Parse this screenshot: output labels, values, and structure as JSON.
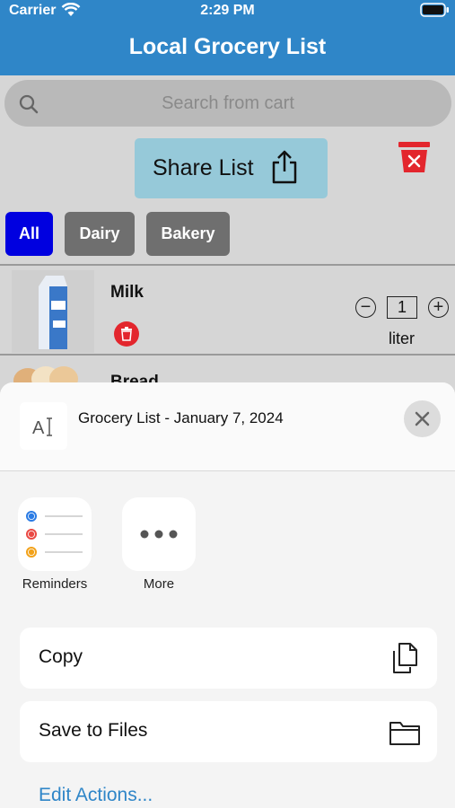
{
  "status": {
    "carrier": "Carrier",
    "time": "2:29 PM"
  },
  "app": {
    "title": "Local Grocery List"
  },
  "search": {
    "placeholder": "Search from cart"
  },
  "share": {
    "label": "Share List"
  },
  "categories": [
    {
      "label": "All",
      "selected": true
    },
    {
      "label": "Dairy",
      "selected": false
    },
    {
      "label": "Bakery",
      "selected": false
    }
  ],
  "items": [
    {
      "name": "Milk",
      "quantity": "1",
      "unit": "liter"
    },
    {
      "name": "Bread"
    }
  ],
  "share_sheet": {
    "doc_title": "Grocery List - January 7, 2024",
    "apps": [
      {
        "label": "Reminders"
      },
      {
        "label": "More"
      }
    ],
    "actions": [
      {
        "label": "Copy"
      },
      {
        "label": "Save to Files"
      }
    ],
    "edit_actions": "Edit Actions..."
  },
  "colors": {
    "header": "#2f86c8",
    "selected_category": "#0000e0",
    "delete_red": "#e3262d"
  }
}
